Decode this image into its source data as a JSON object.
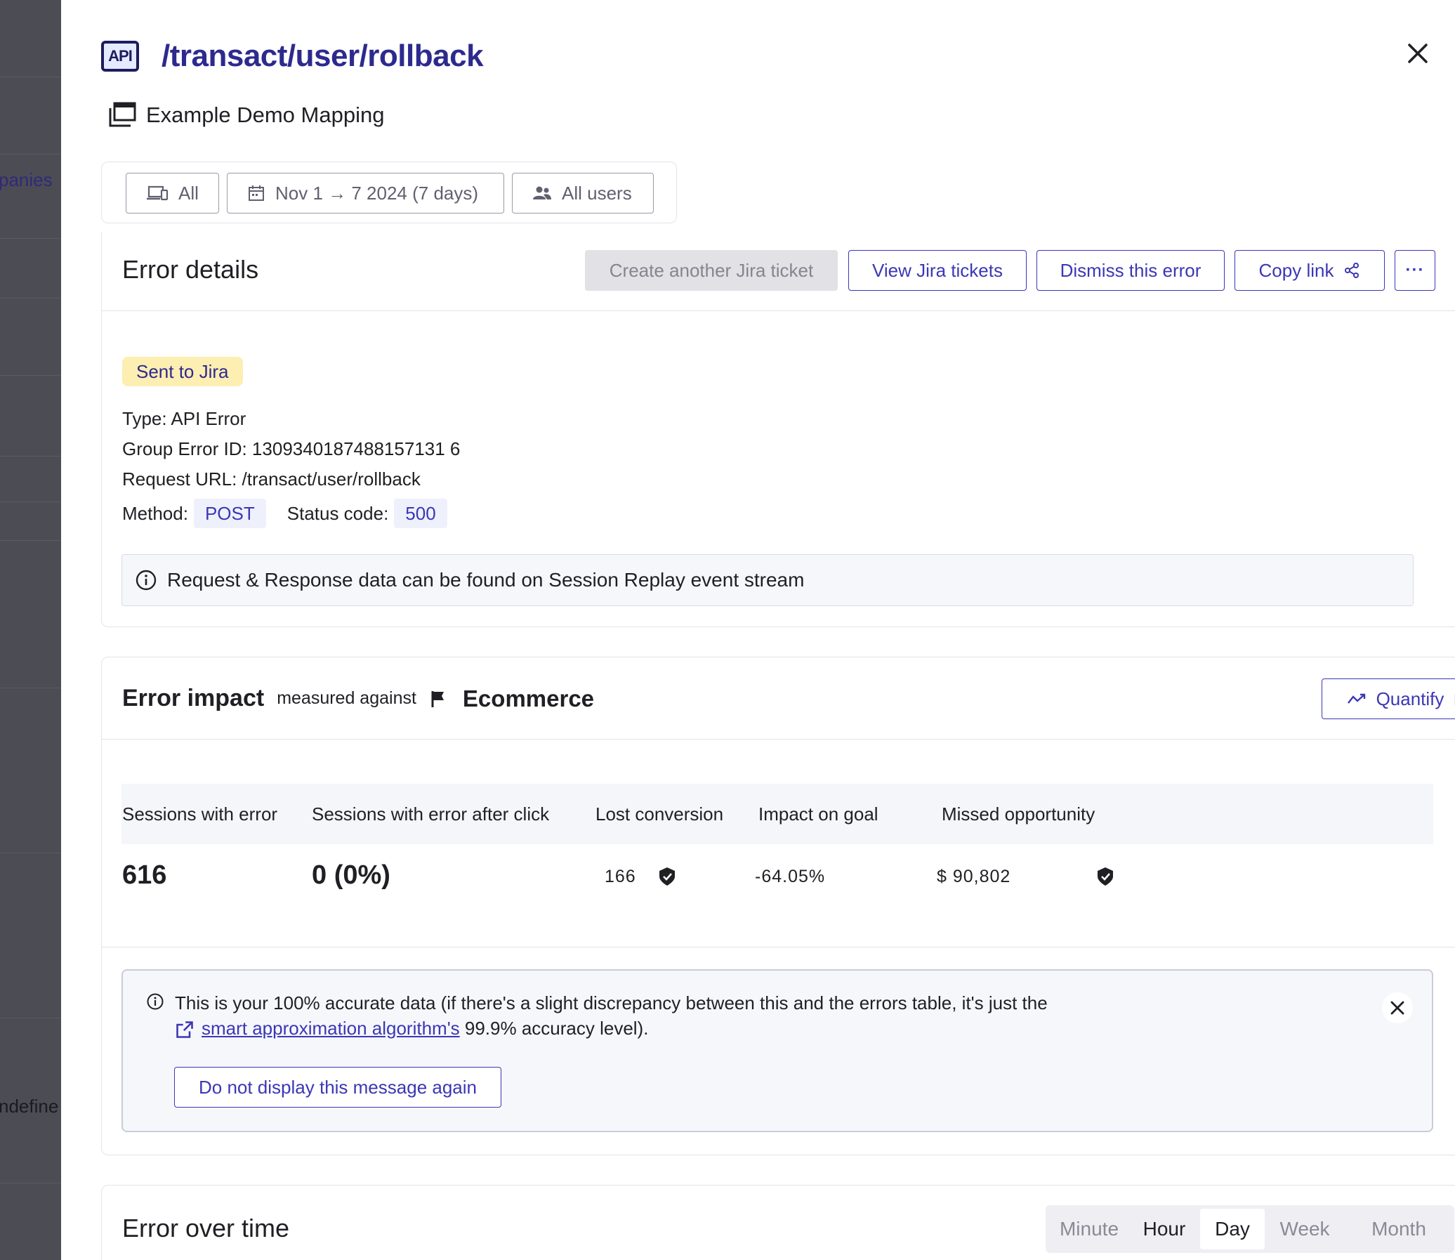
{
  "backdrop": {
    "partial_link": "panies",
    "partial_text": "ndefine"
  },
  "header": {
    "api_badge": "API",
    "title": "/transact/user/rollback",
    "mapping": "Example Demo Mapping"
  },
  "filters": {
    "device": "All",
    "date_range": "Nov 1 → 7 2024 (7 days)",
    "users": "All users"
  },
  "details": {
    "title": "Error details",
    "buttons": {
      "create_jira": "Create another Jira ticket",
      "view_jira": "View Jira tickets",
      "dismiss": "Dismiss this error",
      "copy_link": "Copy link",
      "more": "···"
    },
    "badge": "Sent to Jira",
    "type": "Type: API Error",
    "group_error_id": "Group Error ID: 1309340187488157131 6",
    "request_url": "Request URL: /transact/user/rollback",
    "method_label": "Method:",
    "method_value": "POST",
    "status_label": "Status code:",
    "status_value": "500",
    "info": "Request & Response data can be found on Session Replay event stream"
  },
  "impact": {
    "title": "Error impact",
    "measured": "measured against",
    "goal": "Ecommerce",
    "quantify": "Quantify",
    "headers": {
      "sessions": "Sessions with error",
      "after_click": "Sessions with error after click",
      "lost": "Lost conversion",
      "impact": "Impact on goal",
      "missed": "Missed opportunity"
    },
    "values": {
      "sessions": "616",
      "after_click": "0 (0%)",
      "lost": "166",
      "impact": "-64.05%",
      "missed": "$ 90,802"
    },
    "notice": {
      "line1": "This is your 100% accurate data (if there's a slight discrepancy between this and the errors table, it's just the",
      "link": "smart approximation algorithm's",
      "line2_tail": " 99.9% accuracy level).",
      "button": "Do not display this message again"
    }
  },
  "over_time": {
    "title": "Error over time",
    "granularity": [
      "Minute",
      "Hour",
      "Day",
      "Week",
      "Month"
    ],
    "selected": "Day"
  },
  "colors": {
    "accent": "#3b37b5",
    "title": "#2d2a8e",
    "badge_bg": "#fdeeb2",
    "backdrop": "#4c4c55"
  }
}
